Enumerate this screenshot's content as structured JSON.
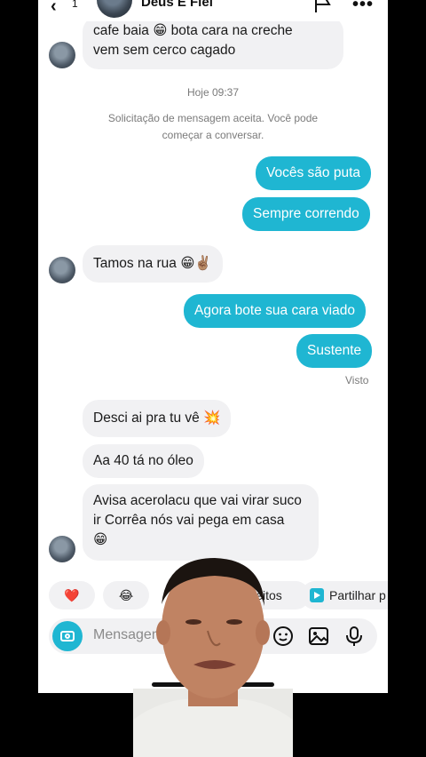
{
  "header": {
    "back_count": "1",
    "name": "Deus E Fiel"
  },
  "messages_top": {
    "line1": "cafe baia 😁 bota cara na creche",
    "line2": "vem sem cerco cagado"
  },
  "timestamp": "Hoje 09:37",
  "system_message": "Solicitação de mensagem aceita. Você pode começar a conversar.",
  "chat": {
    "out1": "Vocês são puta",
    "out2": "Sempre correndo",
    "in1": "Tamos na rua 😁✌🏽",
    "out3": "Agora bote sua cara viado",
    "out4": "Sustente",
    "seen": "Visto",
    "in2": "Desci ai pra tu vê 💥",
    "in3": "Aa 40 tá no óleo",
    "in4_line1": "Avisa acerolacu que vai virar suco",
    "in4_line2": "ir Corrêa nós vai pega em casa",
    "in4_line3": "😁"
  },
  "reactions": {
    "heart": "❤️",
    "laugh": "😂",
    "effects": "Efeitos",
    "share": "Partilhar p"
  },
  "input": {
    "placeholder": "Mensagem"
  },
  "colors": {
    "accent": "#1fb6d2",
    "incoming_bg": "#f1f1f3"
  }
}
